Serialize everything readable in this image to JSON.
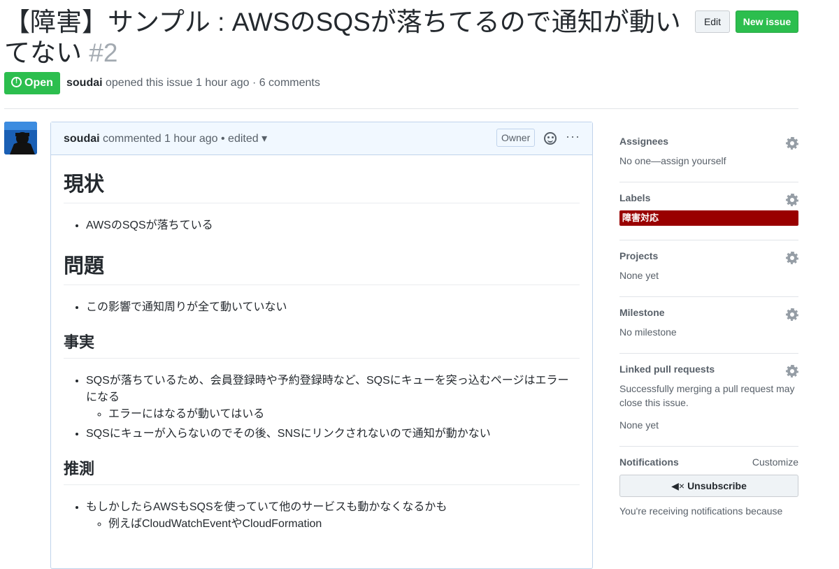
{
  "issue": {
    "title": "【障害】サンプル : AWSのSQSが落ちてるので通知が動いてない",
    "number": "#2",
    "status": "Open",
    "author": "soudai",
    "opened_text": " opened this issue 1 hour ago · 6 comments"
  },
  "header_buttons": {
    "edit": "Edit",
    "new_issue": "New issue"
  },
  "comment": {
    "author": "soudai",
    "meta_text": " commented 1 hour ago • edited ▾",
    "owner_badge": "Owner",
    "more_label": "···",
    "sections": [
      {
        "heading": "現状",
        "items": [
          "AWSのSQSが落ちている"
        ]
      },
      {
        "heading": "問題",
        "items": [
          "この影響で通知周りが全て動いていない"
        ]
      },
      {
        "heading": "事実",
        "items": [
          "SQSが落ちているため、会員登録時や予約登録時など、SQSにキューを突っ込むページはエラーになる",
          "エラーにはなるが動いてはいる",
          "SQSにキューが入らないのでその後、SNSにリンクされないので通知が動かない"
        ]
      },
      {
        "heading": "推測",
        "items": [
          "もしかしたらAWSもSQSを使っていて他のサービスも動かなくなるかも",
          "例えばCloudWatchEventやCloudFormation"
        ]
      }
    ]
  },
  "sidebar": {
    "assignees": {
      "title": "Assignees",
      "value": "No one—assign yourself"
    },
    "labels": {
      "title": "Labels",
      "items": [
        {
          "name": "障害対応",
          "color": "#990000"
        }
      ]
    },
    "projects": {
      "title": "Projects",
      "value": "None yet"
    },
    "milestone": {
      "title": "Milestone",
      "value": "No milestone"
    },
    "linked_prs": {
      "title": "Linked pull requests",
      "description": "Successfully merging a pull request may close this issue.",
      "value": "None yet"
    },
    "notifications": {
      "title": "Notifications",
      "customize": "Customize",
      "unsubscribe": "Unsubscribe",
      "reason": "You're receiving notifications because"
    }
  }
}
